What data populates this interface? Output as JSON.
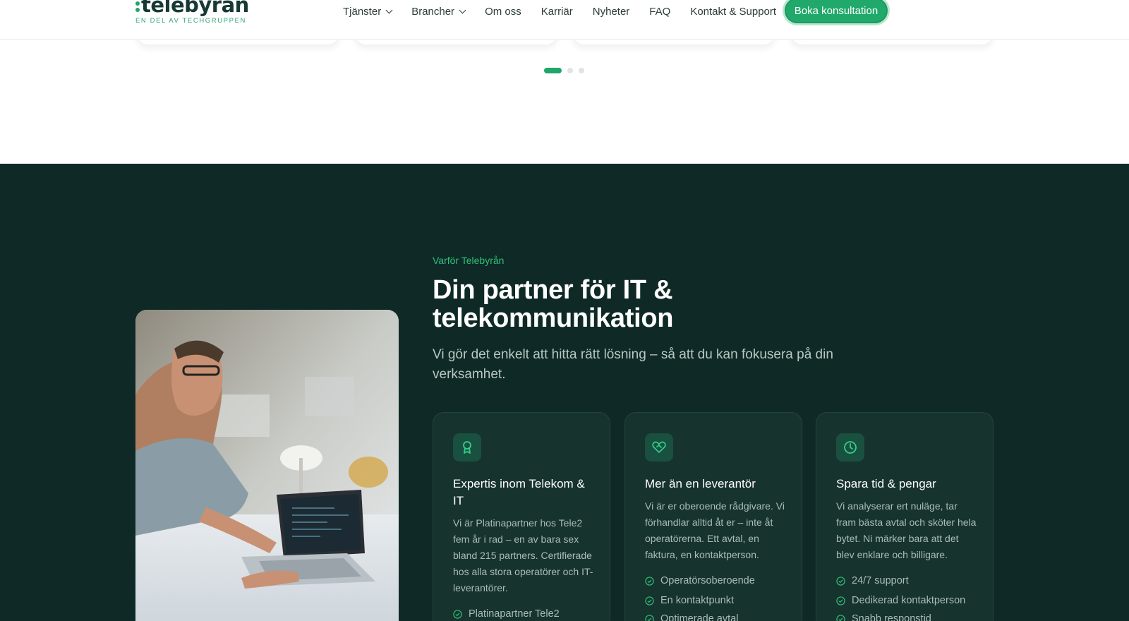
{
  "header": {
    "logo_word": "telebyrån",
    "logo_tagline": "EN DEL AV TECHGRUPPEN",
    "nav": [
      {
        "label": "Tjänster",
        "has_dropdown": true
      },
      {
        "label": "Brancher",
        "has_dropdown": true
      },
      {
        "label": "Om oss",
        "has_dropdown": false
      },
      {
        "label": "Karriär",
        "has_dropdown": false
      },
      {
        "label": "Nyheter",
        "has_dropdown": false
      },
      {
        "label": "FAQ",
        "has_dropdown": false
      },
      {
        "label": "Kontakt & Support",
        "has_dropdown": false
      }
    ],
    "cta_label": "Boka konsultation"
  },
  "carousel": {
    "slides": 3,
    "active_index": 0
  },
  "why": {
    "eyebrow": "Varför Telebyrån",
    "heading": "Din partner för IT & telekommunikation",
    "lede": "Vi gör det enkelt att hitta rätt lösning – så att du kan fokusera på din verksamhet.",
    "cards": [
      {
        "icon": "award-icon",
        "title": "Expertis inom Telekom & IT",
        "description": "Vi är Platinapartner hos Tele2 fem år i rad – en av bara sex bland 215 partners. Certifierade hos alla stora operatörer och IT-leverantörer.",
        "features": [
          "Platinapartner Tele2"
        ]
      },
      {
        "icon": "heart-handshake-icon",
        "title": "Mer än en leverantör",
        "description": "Vi är er oberoende rådgivare. Vi förhandlar alltid åt er – inte åt operatörerna. Ett avtal, en faktura, en kontaktperson.",
        "features": [
          "Operatörsoberoende",
          "En kontaktpunkt",
          "Optimerade avtal"
        ]
      },
      {
        "icon": "clock-icon",
        "title": "Spara tid & pengar",
        "description": "Vi analyserar ert nuläge, tar fram bästa avtal och sköter hela bytet. Ni märker bara att det blev enklare och billigare.",
        "features": [
          "24/7 support",
          "Dedikerad kontaktperson",
          "Snabb responstid"
        ]
      }
    ]
  },
  "colors": {
    "accent": "#21a86b",
    "dark_bg": "#0f2a26",
    "card_bg": "#17332e"
  }
}
